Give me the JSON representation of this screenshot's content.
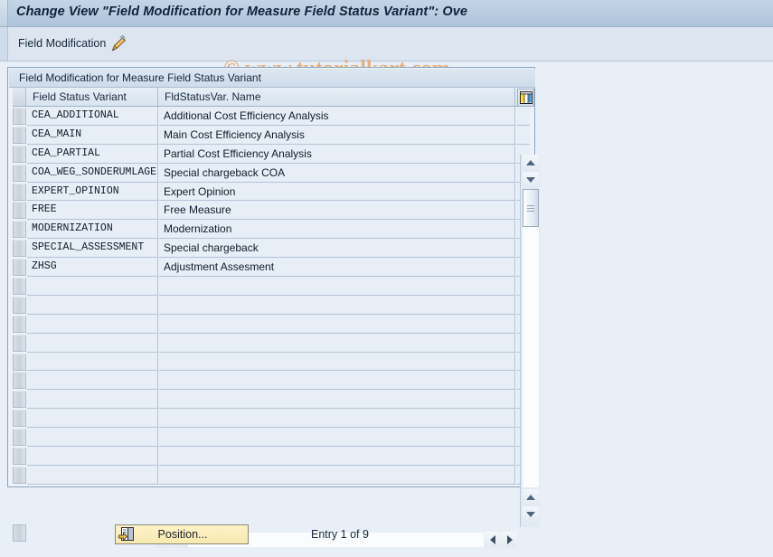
{
  "window": {
    "title": "Change View \"Field Modification for Measure Field Status Variant\": Ove"
  },
  "toolbar": {
    "field_modification_label": "Field Modification",
    "pencil_icon": "pencil-icon"
  },
  "watermark": {
    "text": "© www.tutorialkart.com",
    "color": "#e4b183"
  },
  "panel": {
    "header": "Field Modification for Measure Field Status Variant"
  },
  "table": {
    "columns": [
      {
        "key": "variant",
        "label": "Field Status Variant"
      },
      {
        "key": "name",
        "label": "FldStatusVar. Name"
      }
    ],
    "column_config_icon": "table-settings-icon",
    "rows": [
      {
        "variant": "CEA_ADDITIONAL",
        "name": "Additional Cost Efficiency Analysis"
      },
      {
        "variant": "CEA_MAIN",
        "name": "Main Cost Efficiency Analysis"
      },
      {
        "variant": "CEA_PARTIAL",
        "name": "Partial Cost Efficiency Analysis"
      },
      {
        "variant": "COA_WEG_SONDERUMLAGE",
        "name": "Special chargeback COA"
      },
      {
        "variant": "EXPERT_OPINION",
        "name": "Expert Opinion"
      },
      {
        "variant": "FREE",
        "name": "Free Measure"
      },
      {
        "variant": "MODERNIZATION",
        "name": "Modernization"
      },
      {
        "variant": "SPECIAL_ASSESSMENT",
        "name": "Special chargeback"
      },
      {
        "variant": "ZHSG",
        "name": "Adjustment Assesment"
      },
      {
        "variant": "",
        "name": ""
      },
      {
        "variant": "",
        "name": ""
      },
      {
        "variant": "",
        "name": ""
      },
      {
        "variant": "",
        "name": ""
      },
      {
        "variant": "",
        "name": ""
      },
      {
        "variant": "",
        "name": ""
      },
      {
        "variant": "",
        "name": ""
      },
      {
        "variant": "",
        "name": ""
      },
      {
        "variant": "",
        "name": ""
      },
      {
        "variant": "",
        "name": ""
      },
      {
        "variant": "",
        "name": ""
      }
    ]
  },
  "scrollbars": {
    "vertical_up_icon": "triangle-up-icon",
    "vertical_down_icon": "triangle-down-icon",
    "horizontal_left_icon": "triangle-left-icon",
    "horizontal_right_icon": "triangle-right-icon"
  },
  "footer": {
    "position_button_label": "Position...",
    "position_button_icon": "position-icon",
    "entry_status": "Entry 1 of 9"
  }
}
